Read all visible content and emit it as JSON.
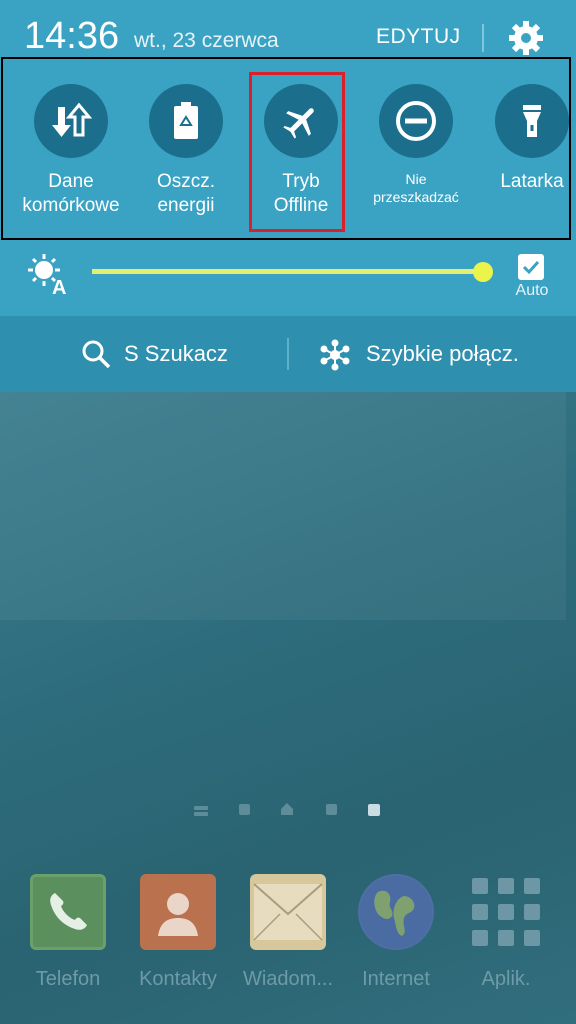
{
  "status": {
    "time": "14:36",
    "date": "wt., 23 czerwca",
    "edit_label": "EDYTUJ"
  },
  "toggles": [
    {
      "label_line1": "Dane",
      "label_line2": "komórkowe",
      "icon": "mobile-data-icon"
    },
    {
      "label_line1": "Oszcz.",
      "label_line2": "energii",
      "icon": "power-saving-icon"
    },
    {
      "label_line1": "Tryb",
      "label_line2": "Offline",
      "icon": "airplane-icon"
    },
    {
      "label_line1": "Nie",
      "label_line2": "przeszkadzać",
      "icon": "do-not-disturb-icon"
    },
    {
      "label_line1": "Latarka",
      "label_line2": "",
      "icon": "flashlight-icon"
    }
  ],
  "brightness": {
    "auto_label": "Auto",
    "auto_checked": true,
    "level": 1.0
  },
  "search": {
    "s_finder_label": "S Szukacz",
    "quick_connect_label": "Szybkie połącz."
  },
  "home": {
    "page_indicator": {
      "pages": 5,
      "current": 5
    },
    "dock": [
      {
        "label": "Telefon",
        "icon": "phone-icon"
      },
      {
        "label": "Kontakty",
        "icon": "contacts-icon"
      },
      {
        "label": "Wiadom...",
        "icon": "messages-icon"
      },
      {
        "label": "Internet",
        "icon": "internet-globe-icon"
      },
      {
        "label": "Aplik.",
        "icon": "apps-grid-icon"
      }
    ]
  },
  "colors": {
    "panel": "#3aa3c3",
    "toggle_circle": "#1b6f8d",
    "highlight": "#d9212b",
    "slider": "#e4f06d"
  }
}
